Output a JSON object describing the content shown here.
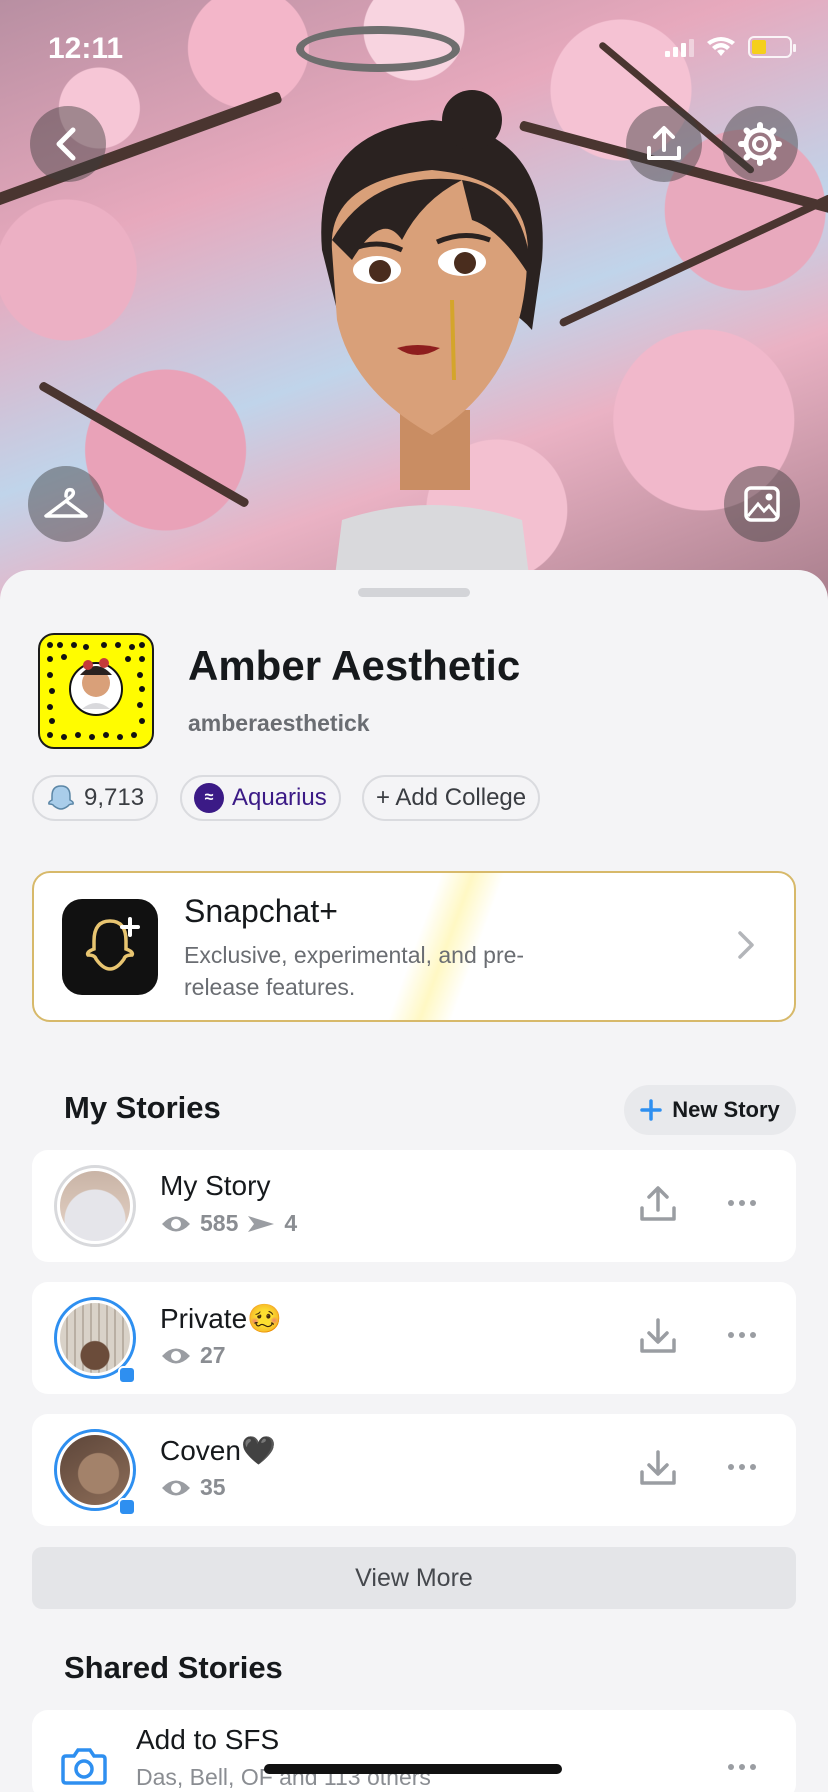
{
  "status_bar": {
    "time": "12:11"
  },
  "profile": {
    "display_name": "Amber Aesthetic",
    "username": "amberaesthetick",
    "snapscore": "9,713",
    "zodiac": "Aquarius",
    "add_college": "+ Add College"
  },
  "snapchat_plus": {
    "title": "Snapchat+",
    "description": "Exclusive, experimental, and pre-release features."
  },
  "my_stories": {
    "title": "My Stories",
    "new_story_label": "New Story",
    "items": [
      {
        "name": "My Story",
        "views": "585",
        "screenshots": "4",
        "action": "upload"
      },
      {
        "name": "Private🥴",
        "views": "27",
        "action": "download"
      },
      {
        "name": "Coven🖤",
        "views": "35",
        "action": "download"
      }
    ],
    "view_more": "View More"
  },
  "shared_stories": {
    "title": "Shared Stories",
    "items": [
      {
        "name": "Add to SFS",
        "subtitle": "Das, Bell, OF and 113 others"
      }
    ]
  },
  "colors": {
    "snap_yellow": "#fffc00",
    "accent_blue": "#2e8ff0",
    "zodiac_purple": "#3b1a86",
    "plus_gold": "#d7b96a"
  },
  "icons": [
    "back-icon",
    "upload-icon",
    "settings-icon",
    "hanger-icon",
    "image-icon",
    "ghost-icon",
    "eye-icon",
    "screenshot-icon",
    "download-icon",
    "more-icon",
    "camera-icon",
    "chevron-right-icon"
  ]
}
